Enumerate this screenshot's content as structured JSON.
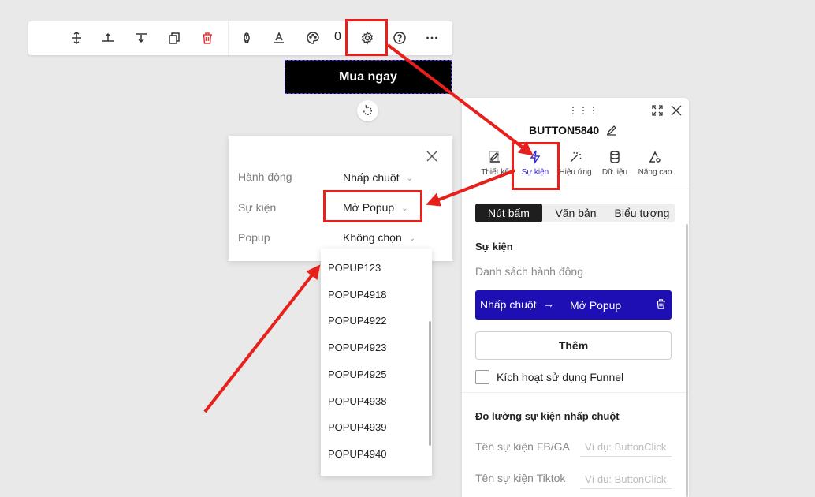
{
  "toolbar": {
    "icons": [
      "move-vertical-icon",
      "align-top-icon",
      "align-bottom-icon",
      "duplicate-icon",
      "trash-icon",
      "link-icon",
      "text-format-icon",
      "palette-icon",
      "settings-icon",
      "help-icon",
      "more-icon"
    ],
    "count": "0"
  },
  "canvas": {
    "button_label": "Mua ngay"
  },
  "event_popover": {
    "rows": [
      {
        "label": "Hành động",
        "value": "Nhấp chuột"
      },
      {
        "label": "Sự kiện",
        "value": "Mở Popup"
      },
      {
        "label": "Popup",
        "value": "Không chọn"
      }
    ]
  },
  "popup_list": [
    "POPUP123",
    "POPUP4918",
    "POPUP4922",
    "POPUP4923",
    "POPUP4925",
    "POPUP4938",
    "POPUP4939",
    "POPUP4940"
  ],
  "panel": {
    "title": "BUTTON5840",
    "tabs": [
      {
        "label": "Thiết kế",
        "icon": "edit-icon"
      },
      {
        "label": "Sự kiện",
        "icon": "lightning-icon"
      },
      {
        "label": "Hiệu ứng",
        "icon": "magic-wand-icon"
      },
      {
        "label": "Dữ liệu",
        "icon": "database-icon"
      },
      {
        "label": "Nâng cao",
        "icon": "advanced-settings-icon"
      }
    ],
    "segments": [
      "Nút bấm",
      "Văn bản",
      "Biểu tượng"
    ],
    "section_title": "Sự kiện",
    "action_list_label": "Danh sách hành động",
    "action": {
      "trigger": "Nhấp chuột",
      "arrow": "→",
      "result": "Mở Popup"
    },
    "add_label": "Thêm",
    "funnel_label": "Kích hoạt sử dụng Funnel",
    "tracking_title": "Đo lường sự kiện nhấp chuột",
    "fields": [
      {
        "label": "Tên sự kiện FB/GA",
        "placeholder": "Ví dụ: ButtonClick"
      },
      {
        "label": "Tên sự kiện Tiktok",
        "placeholder": "Ví dụ: ButtonClick"
      }
    ]
  },
  "colors": {
    "accent": "#1d0fb4",
    "highlight": "#e8201c",
    "danger": "#e53935"
  }
}
